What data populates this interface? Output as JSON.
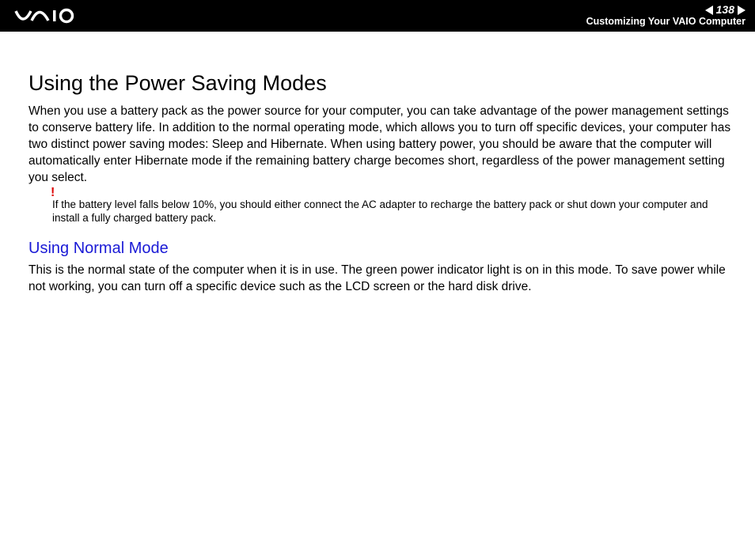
{
  "header": {
    "page_number": "138",
    "breadcrumb": "Customizing Your VAIO Computer"
  },
  "main": {
    "title": "Using the Power Saving Modes",
    "intro": "When you use a battery pack as the power source for your computer, you can take advantage of the power management settings to conserve battery life. In addition to the normal operating mode, which allows you to turn off specific devices, your computer has two distinct power saving modes: Sleep and Hibernate. When using battery power, you should be aware that the computer will automatically enter Hibernate mode if the remaining battery charge becomes short, regardless of the power management setting you select.",
    "note_mark": "!",
    "note_text": "If the battery level falls below 10%, you should either connect the AC adapter to recharge the battery pack or shut down your computer and install a fully charged battery pack.",
    "subheading": "Using Normal Mode",
    "sub_text": "This is the normal state of the computer when it is in use. The green power indicator light is on in this mode. To save power while not working, you can turn off a specific device such as the LCD screen or the hard disk drive."
  }
}
